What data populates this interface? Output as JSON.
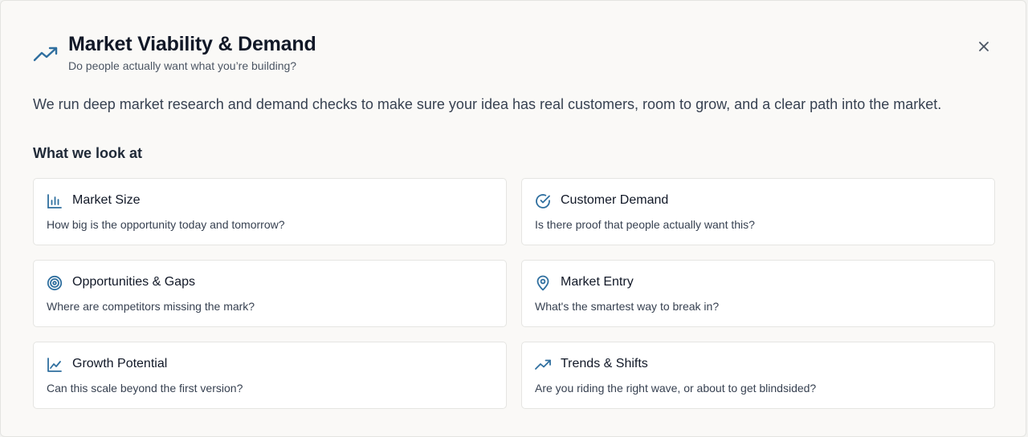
{
  "dialog": {
    "title": "Market Viability & Demand",
    "subtitle": "Do people actually want what you’re building?",
    "intro": "We run deep market research and demand checks to make sure your idea has real customers, room to grow, and a clear path into the market.",
    "section_title": "What we look at",
    "header_icon": "trending-up-icon",
    "close_icon": "close-icon",
    "accent_color": "#2f6f9f"
  },
  "cards": [
    {
      "icon": "bar-chart-icon",
      "title": "Market Size",
      "description": "How big is the opportunity today and tomorrow?"
    },
    {
      "icon": "check-circle-icon",
      "title": "Customer Demand",
      "description": "Is there proof that people actually want this?"
    },
    {
      "icon": "target-icon",
      "title": "Opportunities & Gaps",
      "description": "Where are competitors missing the mark?"
    },
    {
      "icon": "map-pin-icon",
      "title": "Market Entry",
      "description": "What's the smartest way to break in?"
    },
    {
      "icon": "line-chart-icon",
      "title": "Growth Potential",
      "description": "Can this scale beyond the first version?"
    },
    {
      "icon": "trending-up-icon",
      "title": "Trends & Shifts",
      "description": "Are you riding the right wave, or about to get blindsided?"
    }
  ]
}
